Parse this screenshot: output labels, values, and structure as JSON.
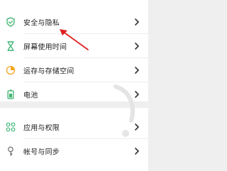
{
  "settings": {
    "group1": [
      {
        "label": "安全与隐私",
        "icon": "shield-check-icon"
      },
      {
        "label": "屏幕使用时间",
        "icon": "hourglass-icon"
      },
      {
        "label": "运存与存储空间",
        "icon": "storage-pie-icon"
      },
      {
        "label": "电池",
        "icon": "battery-icon"
      }
    ],
    "group2": [
      {
        "label": "应用与权限",
        "icon": "app-grid-icon"
      },
      {
        "label": "帐号与同步",
        "icon": "account-key-icon"
      }
    ]
  },
  "colors": {
    "accent_green": "#3cb371",
    "accent_orange": "#f5a623",
    "arrow_red": "#e02020",
    "chevron": "#333333"
  }
}
